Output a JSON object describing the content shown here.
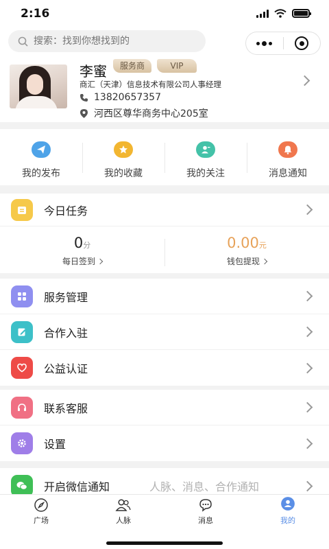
{
  "status_bar": {
    "time": "2:16"
  },
  "search": {
    "placeholder": "搜索：找到你想找到的"
  },
  "profile": {
    "name": "李蜜",
    "tags": [
      "服务商",
      "VIP"
    ],
    "company": "商汇（天津）信息技术有限公司人事经理",
    "phone": "13820657357",
    "address": "河西区尊华商务中心205室"
  },
  "quick_actions": [
    {
      "label": "我的发布",
      "icon": "send-icon",
      "color": "#4ea3e8"
    },
    {
      "label": "我的收藏",
      "icon": "star-icon",
      "color": "#f2b631"
    },
    {
      "label": "我的关注",
      "icon": "follow-icon",
      "color": "#44c2a8"
    },
    {
      "label": "消息通知",
      "icon": "bell-icon",
      "color": "#f0774e"
    }
  ],
  "task": {
    "title": "今日任务",
    "points_value": "0",
    "points_unit": "分",
    "points_label": "每日签到",
    "wallet_value": "0.00",
    "wallet_unit": "元",
    "wallet_label": "钱包提现"
  },
  "menu_group_1": [
    {
      "label": "服务管理",
      "icon": "grid-icon",
      "color": "#8f8ff0"
    },
    {
      "label": "合作入驻",
      "icon": "edit-icon",
      "color": "#3dc0c8"
    },
    {
      "label": "公益认证",
      "icon": "heart-icon",
      "color": "#ee4b47"
    }
  ],
  "menu_group_2": [
    {
      "label": "联系客服",
      "icon": "headset-icon",
      "color": "#f07084"
    },
    {
      "label": "设置",
      "icon": "gear-icon",
      "color": "#9f7ee8"
    }
  ],
  "menu_group_3": [
    {
      "label": "开启微信通知",
      "extra": "人脉、消息、合作通知",
      "icon": "wechat-icon",
      "color": "#3fbf56"
    }
  ],
  "tabs": [
    {
      "label": "广场",
      "icon": "compass-icon"
    },
    {
      "label": "人脉",
      "icon": "people-icon"
    },
    {
      "label": "消息",
      "icon": "chat-icon"
    },
    {
      "label": "我的",
      "icon": "user-icon",
      "active": true
    }
  ],
  "colors": {
    "accent": "#5b8fe6",
    "wallet": "#e7a259"
  }
}
